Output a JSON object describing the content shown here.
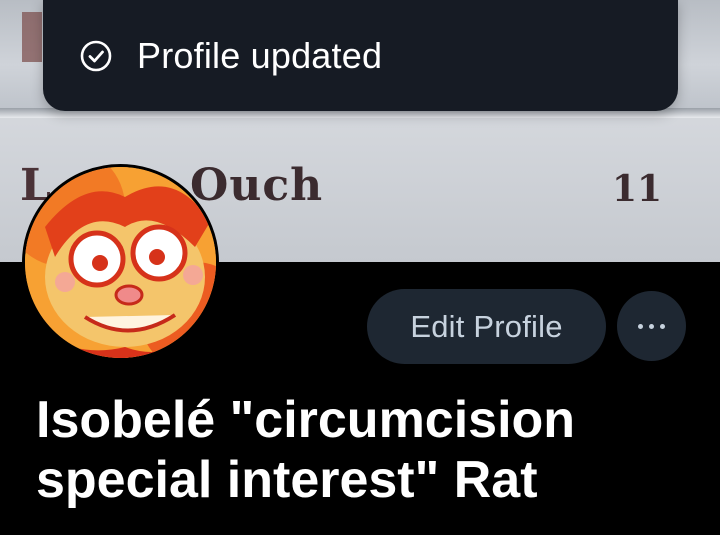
{
  "toast": {
    "message": "Profile updated",
    "icon": "check-circle-icon"
  },
  "banner": {
    "photo_word": "Ouch",
    "photo_number": "11",
    "photo_partial_letter": "L"
  },
  "profile": {
    "display_name": "Isobelé \"circumcision special interest\" Rat",
    "edit_profile_label": "Edit Profile",
    "more_icon": "more-options-icon"
  },
  "colors": {
    "background": "#000000",
    "toast_bg": "#161b24",
    "button_bg": "#1e2732",
    "button_text": "#c7d2de"
  }
}
